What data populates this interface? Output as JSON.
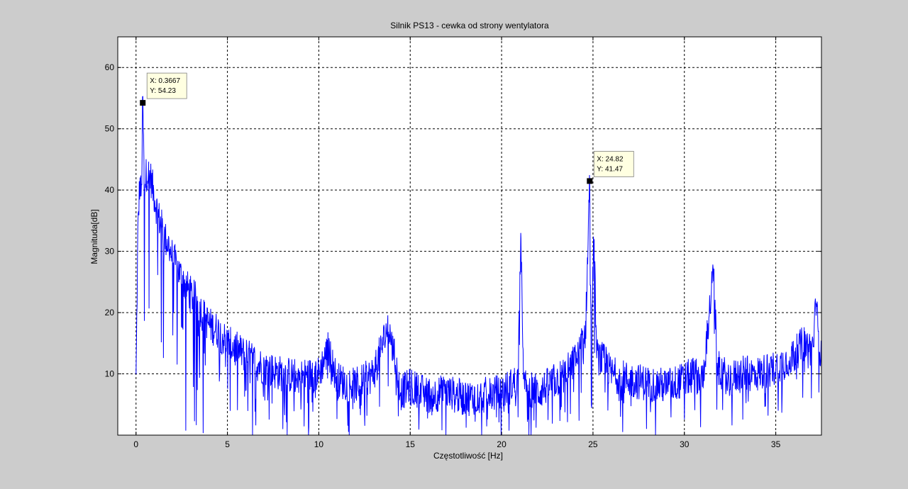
{
  "chart_data": {
    "type": "line",
    "title": "Silnik PS13 - cewka od strony wentylatora",
    "xlabel": "Częstotliwość [Hz]",
    "ylabel": "Magnituda[dB]",
    "xlim": [
      -1,
      37.5
    ],
    "ylim": [
      0,
      65
    ],
    "x_ticks": [
      0,
      5,
      10,
      15,
      20,
      25,
      30,
      35
    ],
    "y_ticks": [
      10,
      20,
      30,
      40,
      50,
      60
    ],
    "grid": true,
    "grid_style": "dashed",
    "line_color": "#0000ff",
    "series": [
      {
        "x": [
          0,
          0.1,
          0.2,
          0.3,
          0.3667,
          0.45,
          0.6,
          0.8,
          1.0,
          1.2,
          1.4,
          1.6,
          1.8,
          2.0,
          2.3,
          2.6,
          3.0,
          3.3,
          3.6,
          4.0,
          4.5,
          5.0,
          5.5,
          6.0,
          6.5,
          7.0,
          8.0,
          9.0,
          10.0,
          10.5,
          11.0,
          12.0,
          13.0,
          13.5,
          13.8,
          14.5,
          15.0,
          16.0,
          17.0,
          18.0,
          19.0,
          20.0,
          20.5,
          20.9,
          21.05,
          21.2,
          22.0,
          23.0,
          23.5,
          24.2,
          24.6,
          24.82,
          24.9,
          25.05,
          25.2,
          25.6,
          26.0,
          27.0,
          28.0,
          29.0,
          30.0,
          30.5,
          31.0,
          31.6,
          31.8,
          32.5,
          33.0,
          34.0,
          35.0,
          36.0,
          36.5,
          37.0,
          37.2,
          37.5
        ],
        "y": [
          8,
          32,
          40,
          38,
          54.23,
          40,
          42,
          41,
          38,
          35,
          33,
          31,
          30,
          28,
          26,
          24,
          22,
          21,
          19,
          17,
          16,
          14,
          13,
          12,
          11,
          10,
          9,
          8.5,
          9,
          13,
          8,
          7,
          9,
          14,
          17,
          6,
          7,
          5.5,
          6,
          5,
          5.5,
          6,
          7,
          8,
          33,
          7,
          6,
          8,
          9,
          12,
          16,
          41.47,
          14,
          32,
          12,
          11,
          9,
          8,
          7.5,
          7,
          8,
          9,
          8,
          26,
          10,
          8,
          9,
          9,
          10,
          12,
          14,
          13,
          20,
          11
        ]
      }
    ],
    "datatips": [
      {
        "x": 0.3667,
        "y": 54.23,
        "x_label": "X: 0.3667",
        "y_label": "Y: 54.23"
      },
      {
        "x": 24.82,
        "y": 41.47,
        "x_label": "X: 24.82",
        "y_label": "Y: 41.47"
      }
    ]
  }
}
